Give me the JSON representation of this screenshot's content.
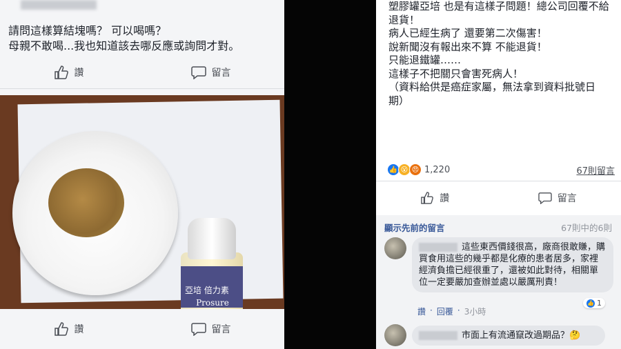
{
  "left_post": {
    "text_lines": [
      "請問這樣算結塊嗎？ 可以喝嗎？",
      "母親不敢喝...我也知道該去哪反應或詢問才對。"
    ],
    "like_label": "讚",
    "comment_label": "留言",
    "photo": {
      "bottle_brand": "Prosure",
      "bottle_cn": "亞培 倍力素"
    }
  },
  "right_post": {
    "text_lines": [
      "塑膠罐亞培 也是有這樣子問題！總公司回覆不給",
      "退貨！",
      "病人已經生病了 還要第二次傷害！",
      "說新聞沒有報出來不算 不能退貨！",
      "只能退鐵罐……",
      "這樣子不把關只會害死病人！",
      "（資料給供是癌症家屬，無法拿到資料批號日",
      "期）"
    ],
    "reaction_count": "1,220",
    "comment_count_label": "67則留言",
    "like_label": "讚",
    "comment_label": "留言",
    "reaction_colors": [
      "#1877f2",
      "#f7b125",
      "#e9710f"
    ]
  },
  "comments_section": {
    "prev_link": "顯示先前的留言",
    "count_text": "67則中的6則",
    "comment1": {
      "text": "這些東西價錢很高，廠商很敢賺，購買食用這些的幾乎都是化療的患者居多，家裡經濟負擔已經很重了，還被如此對待，相關單位一定要嚴加查辦並處以嚴厲刑責！",
      "like_action": "讚",
      "reply_action": "回覆",
      "time": "3小時",
      "like_count": "1"
    },
    "comment2": {
      "text": "市面上有流通竄改過期品？"
    }
  }
}
